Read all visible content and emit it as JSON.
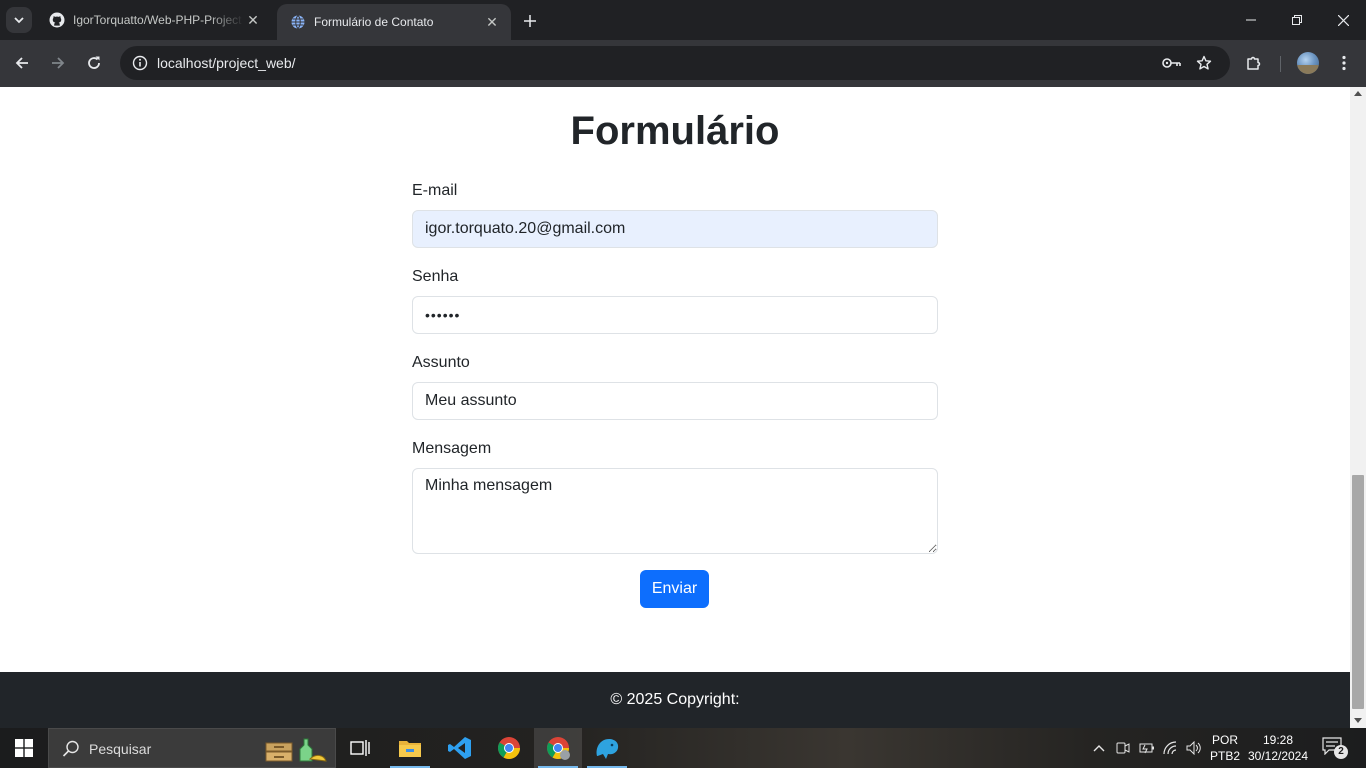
{
  "browser": {
    "tabs": [
      {
        "title": "IgorTorquatto/Web-PHP-Project",
        "active": false
      },
      {
        "title": "Formulário de Contato",
        "active": true
      }
    ],
    "url": "localhost/project_web/"
  },
  "page": {
    "title": "Formulário",
    "fields": {
      "email": {
        "label": "E-mail",
        "value": "igor.torquato.20@gmail.com"
      },
      "password": {
        "label": "Senha",
        "value": "••••••"
      },
      "subject": {
        "label": "Assunto",
        "value": "Meu assunto"
      },
      "message": {
        "label": "Mensagem",
        "value": "Minha mensagem"
      }
    },
    "submit_label": "Enviar",
    "footer": "© 2025 Copyright:"
  },
  "taskbar": {
    "search_placeholder": "Pesquisar",
    "language": "POR",
    "keyboard": "PTB2",
    "time": "19:28",
    "date": "30/12/2024",
    "notification_count": "2"
  },
  "colors": {
    "primary": "#0d6efd",
    "footer_bg": "#212529",
    "autofill_bg": "#e8f0fe"
  }
}
